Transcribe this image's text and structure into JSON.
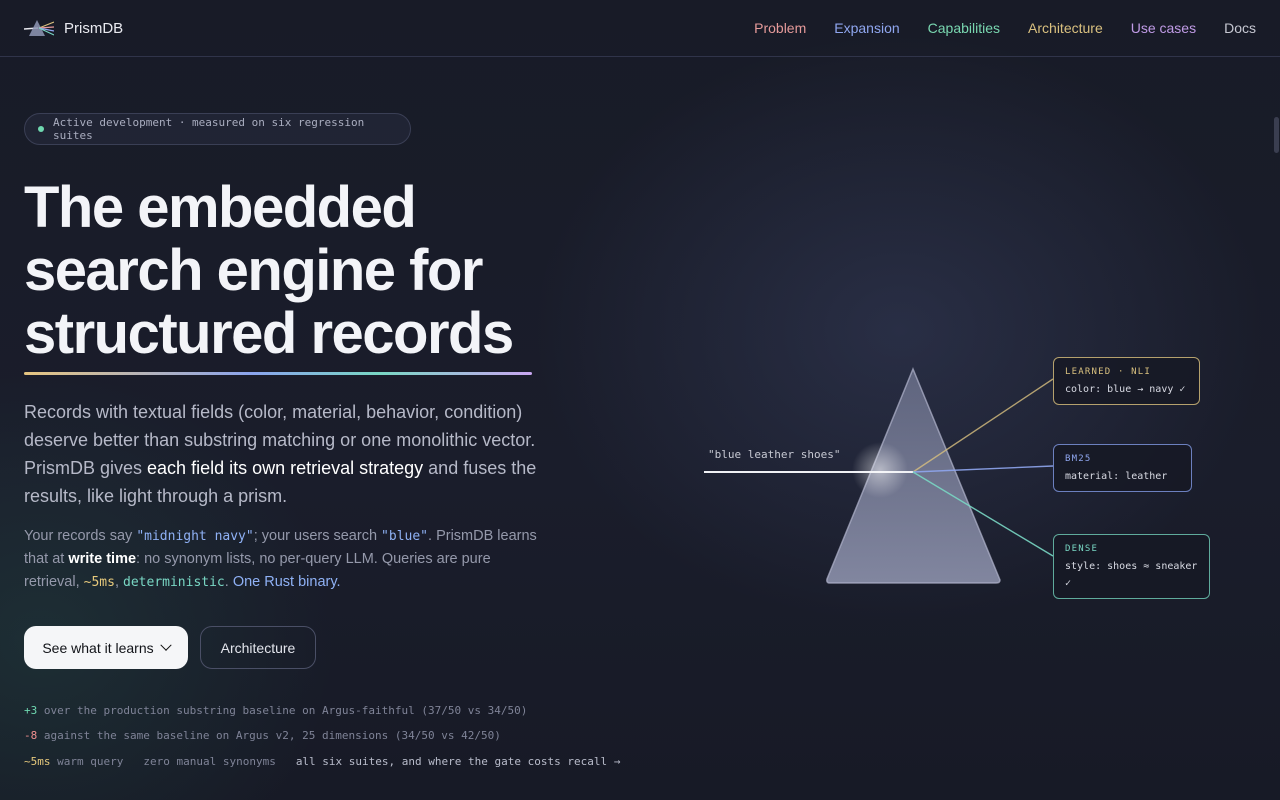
{
  "brand": {
    "name": "PrismDB",
    "icon": "prism-logo-icon"
  },
  "nav": [
    {
      "label": "Problem",
      "color": "#e59a9a"
    },
    {
      "label": "Expansion",
      "color": "#8fa6ef"
    },
    {
      "label": "Capabilities",
      "color": "#79d7b0"
    },
    {
      "label": "Architecture",
      "color": "#d9c07f"
    },
    {
      "label": "Use cases",
      "color": "#c09be6"
    },
    {
      "label": "Docs",
      "color": "#c6c8d2"
    }
  ],
  "badge": {
    "text": "Active development · measured on six regression suites"
  },
  "headline": [
    "The embedded",
    "search engine for",
    "structured records"
  ],
  "lead": {
    "part1": "Records with textual fields (color, material, behavior, condition) deserve better than substring matching or one monolithic vector. PrismDB gives ",
    "strong": "each field its own retrieval strategy",
    "part2": " and fuses the results, like light through a prism."
  },
  "sub": {
    "p1": "Your records say ",
    "code1": "\"midnight navy\"",
    "p2": "; your users search ",
    "code2": "\"blue\"",
    "p3": ". PrismDB learns that at ",
    "strong": "write time",
    "p4": ": no synonym lists, no per-query LLM. Queries are pure retrieval, ",
    "latency": "~5ms",
    "p5": ", ",
    "det": "deterministic",
    "p6": ". ",
    "rust": "One Rust binary."
  },
  "buttons": {
    "primary": "See what it learns",
    "secondary": "Architecture"
  },
  "stats": {
    "line1": {
      "delta": "+3",
      "text": " over the production substring baseline on Argus-faithful (37/50 vs 34/50)"
    },
    "line2": {
      "delta": "-8",
      "text": " against the same baseline on Argus v2, 25 dimensions (34/50 vs 42/50)"
    },
    "line3": {
      "latency": "~5ms",
      "latency_text": " warm query",
      "synonyms": "zero manual synonyms",
      "link": "all six suites, and where the gate costs recall →"
    }
  },
  "diagram": {
    "query": "\"blue leather shoes\"",
    "cards": [
      {
        "caption": "LEARNED · NLI",
        "value": "color: blue → navy ✓",
        "color": "#d9c07f"
      },
      {
        "caption": "BM25",
        "value": "material: leather",
        "color": "#8fa6ef"
      },
      {
        "caption": "DENSE",
        "value": "style: shoes ≈ sneaker ✓",
        "color": "#79d7c4"
      }
    ]
  }
}
